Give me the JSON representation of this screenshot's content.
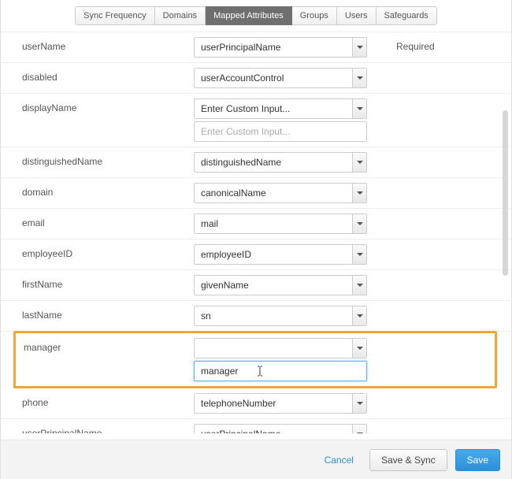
{
  "tabs": [
    {
      "label": "Sync Frequency",
      "active": false
    },
    {
      "label": "Domains",
      "active": false
    },
    {
      "label": "Mapped Attributes",
      "active": true
    },
    {
      "label": "Groups",
      "active": false
    },
    {
      "label": "Users",
      "active": false
    },
    {
      "label": "Safeguards",
      "active": false
    }
  ],
  "required_label": "Required",
  "custom_input_placeholder": "Enter Custom Input...",
  "rows": [
    {
      "label": "userName",
      "value": "userPrincipalName",
      "required": true
    },
    {
      "label": "disabled",
      "value": "userAccountControl"
    },
    {
      "label": "displayName",
      "value": "Enter Custom Input...",
      "custom": true,
      "custom_value": ""
    },
    {
      "label": "distinguishedName",
      "value": "distinguishedName"
    },
    {
      "label": "domain",
      "value": "canonicalName"
    },
    {
      "label": "email",
      "value": "mail"
    },
    {
      "label": "employeeID",
      "value": "employeeID"
    },
    {
      "label": "firstName",
      "value": "givenName"
    },
    {
      "label": "lastName",
      "value": "sn"
    },
    {
      "label": "manager",
      "value": "",
      "custom": true,
      "custom_value": "manager",
      "highlight": true,
      "focused": true
    },
    {
      "label": "phone",
      "value": "telephoneNumber"
    },
    {
      "label": "userPrincipalName",
      "value": "userPrincipalName"
    }
  ],
  "footer": {
    "cancel": "Cancel",
    "save_sync": "Save & Sync",
    "save": "Save"
  }
}
